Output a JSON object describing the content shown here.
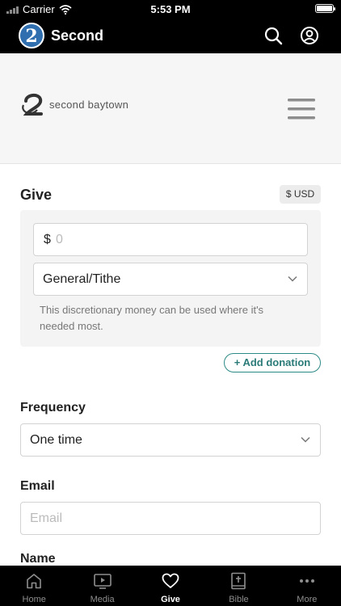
{
  "status_bar": {
    "carrier": "Carrier",
    "time": "5:53 PM"
  },
  "app_header": {
    "logo_glyph": "2",
    "title": "Second",
    "icons": [
      "search-icon",
      "account-icon"
    ]
  },
  "site": {
    "logo_text": "second baytown",
    "icons": [
      "church-logo-icon",
      "hamburger-menu-icon"
    ]
  },
  "give": {
    "title": "Give",
    "currency": "$ USD",
    "amount_prefix": "$",
    "amount_placeholder": "0",
    "fund": "General/Tithe",
    "fund_description": "This discretionary money can be used where it's needed most.",
    "add_donation": "+ Add donation"
  },
  "frequency": {
    "label": "Frequency",
    "value": "One time"
  },
  "email": {
    "label": "Email",
    "placeholder": "Email"
  },
  "name": {
    "label": "Name"
  },
  "tabs": [
    {
      "label": "Home",
      "icon": "home-icon",
      "active": false
    },
    {
      "label": "Media",
      "icon": "media-icon",
      "active": false
    },
    {
      "label": "Give",
      "icon": "heart-icon",
      "active": true
    },
    {
      "label": "Bible",
      "icon": "bible-icon",
      "active": false
    },
    {
      "label": "More",
      "icon": "more-icon",
      "active": false
    }
  ],
  "colors": {
    "accent": "#2a7b78",
    "header_bg": "#000000",
    "logo_blue": "#2f6fb0"
  }
}
